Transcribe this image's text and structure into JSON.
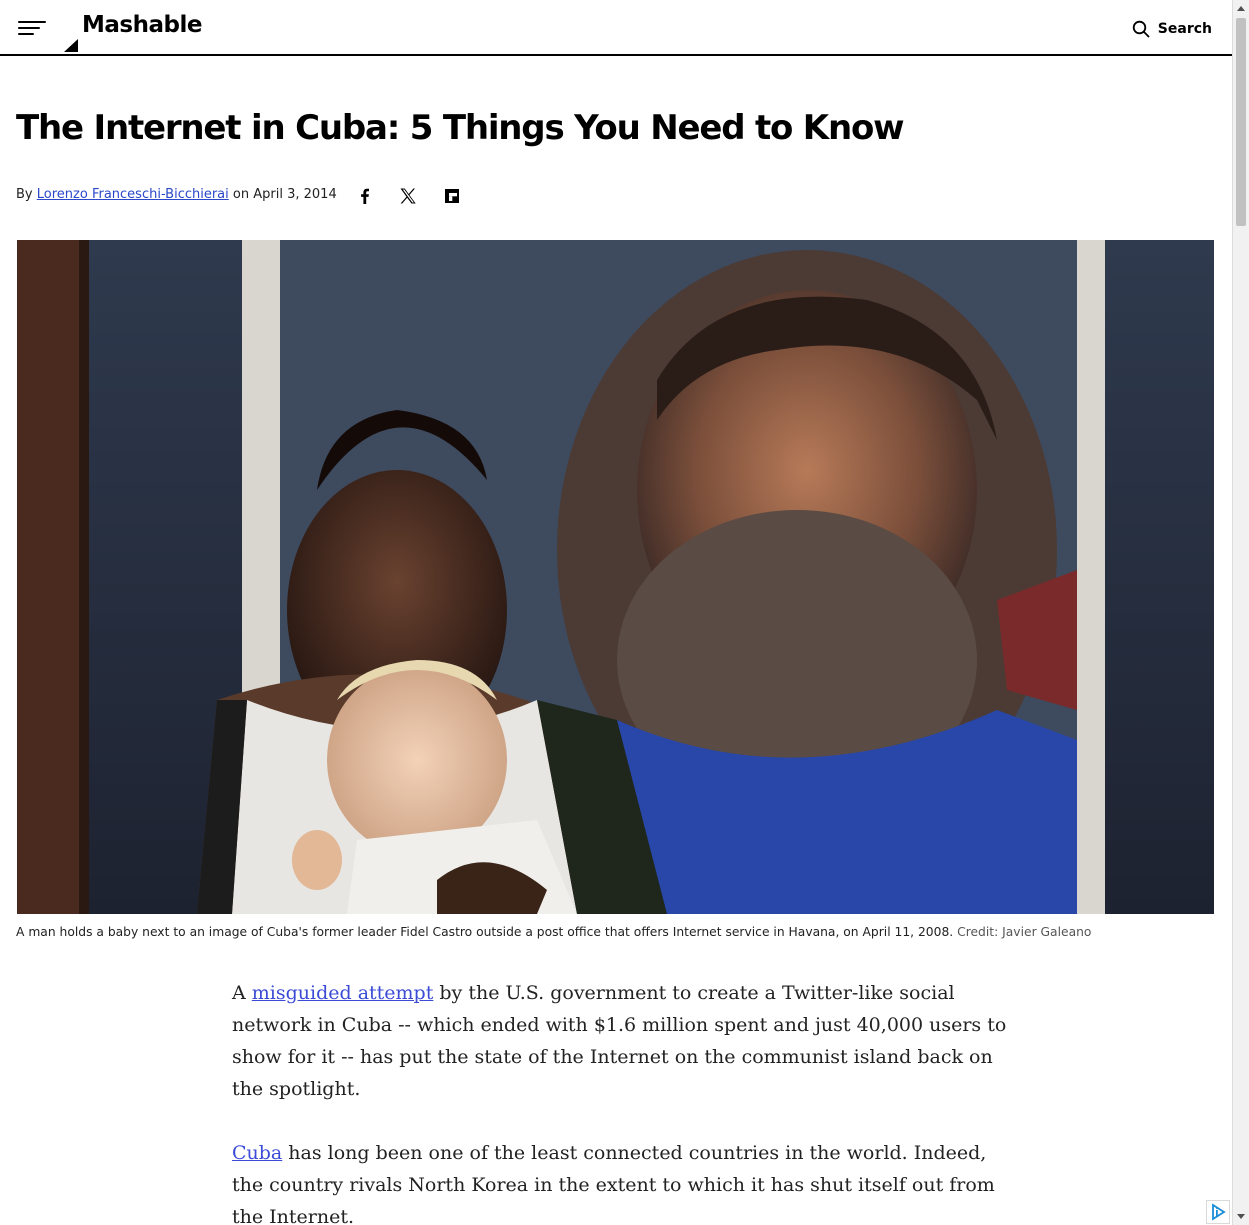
{
  "header": {
    "logo_text": "Mashable",
    "search_label": "Search",
    "menu_icon": "hamburger-menu-icon",
    "search_icon": "magnifier-icon"
  },
  "article": {
    "title": "The Internet in Cuba: 5 Things You Need to Know",
    "byline_prefix": "By",
    "author": "Lorenzo Franceschi-Bicchierai",
    "date_prefix": "on",
    "date": "April 3, 2014",
    "share_icons": [
      "facebook-icon",
      "x-icon",
      "flipboard-icon"
    ],
    "caption": "A man holds a baby next to an image of Cuba's former leader Fidel Castro outside a post office that offers Internet service in Havana, on April 11, 2008.",
    "credit": "Credit: Javier Galeano",
    "paragraphs": [
      {
        "lead": "A ",
        "link": "misguided attempt",
        "rest": " by the U.S. government to create a Twitter-like social network in Cuba -- which ended with $1.6 million spent and just 40,000 users to show for it -- has put the state of the Internet on the communist island back on the spotlight."
      },
      {
        "lead": "",
        "link": "Cuba",
        "rest": " has long been one of the least connected countries in the world. Indeed, the country rivals North Korea in the extent to which it has shut itself out from the Internet."
      }
    ]
  },
  "colors": {
    "link": "#2a48c9",
    "text": "#222222",
    "accent": "#000000"
  }
}
